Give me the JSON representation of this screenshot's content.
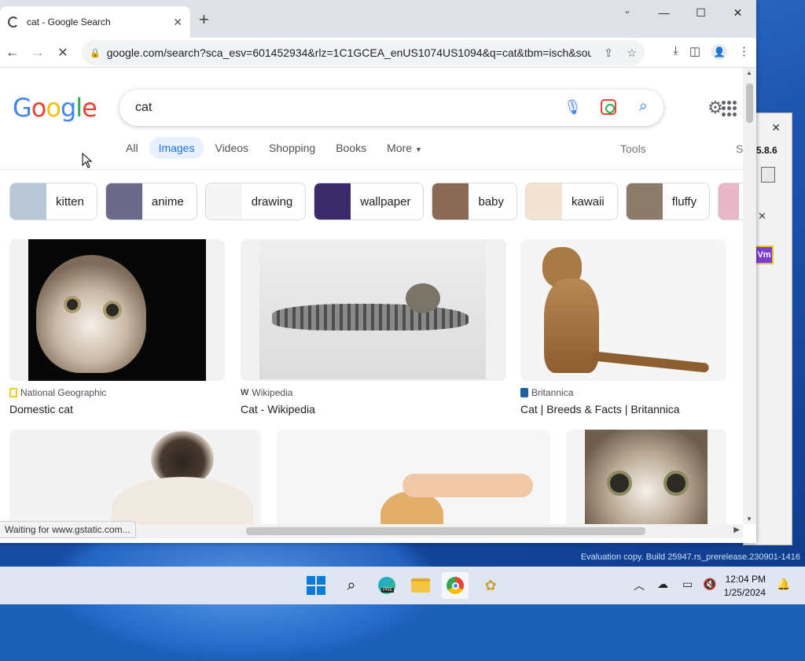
{
  "browser": {
    "tab_title": "cat - Google Search",
    "url": "google.com/search?sca_esv=601452934&rlz=1C1GCEA_enUS1074US1094&q=cat&tbm=isch&sou...",
    "status": "Waiting for www.gstatic.com..."
  },
  "search": {
    "logo": "Google",
    "query": "cat",
    "tabs": [
      "All",
      "Images",
      "Videos",
      "Shopping",
      "Books",
      "More"
    ],
    "active_tab": "Images",
    "tools": "Tools",
    "tools_cut": "S"
  },
  "chips": [
    {
      "label": "kitten",
      "color": "#b9c7d6"
    },
    {
      "label": "anime",
      "color": "#6c6a8a"
    },
    {
      "label": "drawing",
      "color": "#f5f5f5"
    },
    {
      "label": "wallpaper",
      "color": "#3a2a6a"
    },
    {
      "label": "baby",
      "color": "#8a6a55"
    },
    {
      "label": "kawaii",
      "color": "#f2e3d2"
    },
    {
      "label": "fluffy",
      "color": "#8c7b6b"
    }
  ],
  "results": [
    {
      "source": "National Geographic",
      "title": "Domestic cat",
      "source_color": "#f4cc1a"
    },
    {
      "source": "Wikipedia",
      "title": "Cat - Wikipedia",
      "source_color": "#555555"
    },
    {
      "source": "Britannica",
      "title": "Cat | Breeds & Facts | Britannica",
      "source_color": "#1f5fa0"
    }
  ],
  "background_window": {
    "version": "5.8.6",
    "badge": "Vm"
  },
  "desktop": {
    "watermark": "Evaluation copy. Build 25947.rs_prerelease.230901-1416"
  },
  "taskbar": {
    "time": "12:04 PM",
    "date": "1/25/2024",
    "edge_badge": "PRE"
  }
}
